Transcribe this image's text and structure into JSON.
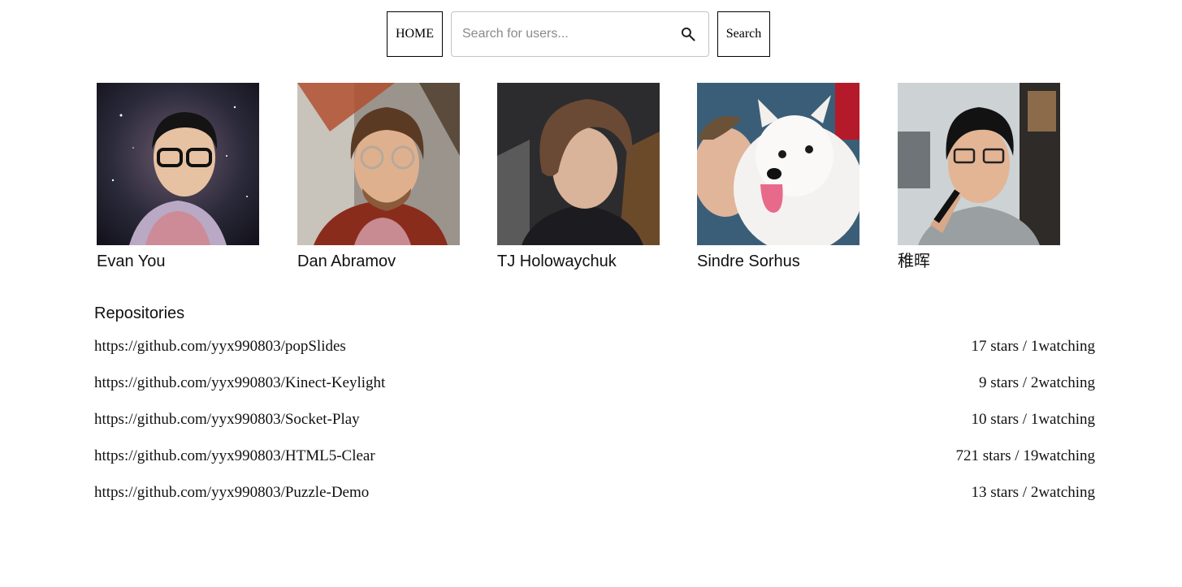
{
  "nav": {
    "home_label": "HOME",
    "search_placeholder": "Search for users...",
    "search_value": "",
    "search_button_label": "Search"
  },
  "users": [
    {
      "name": "Evan You",
      "avatar_bg": "#2b2a3a"
    },
    {
      "name": "Dan Abramov",
      "avatar_bg": "#7a6552"
    },
    {
      "name": "TJ Holowaychuk",
      "avatar_bg": "#2c2c2e"
    },
    {
      "name": "Sindre Sorhus",
      "avatar_bg": "#e9e6e4"
    },
    {
      "name": "稚晖",
      "avatar_bg": "#cdd2d4"
    }
  ],
  "repositories": {
    "title": "Repositories",
    "items": [
      {
        "url": "https://github.com/yyx990803/popSlides",
        "stats": "17 stars / 1watching"
      },
      {
        "url": "https://github.com/yyx990803/Kinect-Keylight",
        "stats": "9 stars / 2watching"
      },
      {
        "url": "https://github.com/yyx990803/Socket-Play",
        "stats": "10 stars / 1watching"
      },
      {
        "url": "https://github.com/yyx990803/HTML5-Clear",
        "stats": "721 stars / 19watching"
      },
      {
        "url": "https://github.com/yyx990803/Puzzle-Demo",
        "stats": "13 stars / 2watching"
      }
    ]
  }
}
